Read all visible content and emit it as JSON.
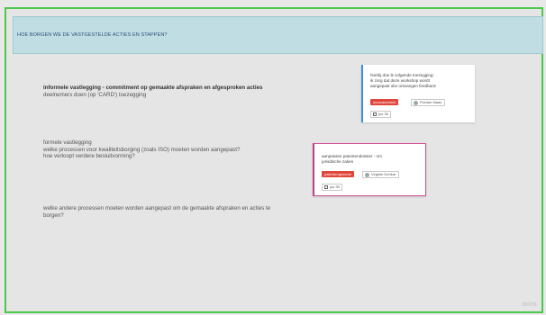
{
  "header": {
    "title": "HOE BORGEN WE DE VASTGESTELDE ACTIES EN STAPPEN?"
  },
  "blocks": [
    {
      "line1": "informele vastlegging - commitment op gemaakte afspraken en afgesproken acties",
      "line2": "deelnemers doen (op 'CARD') toezegging"
    },
    {
      "line1": "formele vastlegging",
      "line2": "welke processen voor kwaliteitsborging (zoals ISO) moeten worden aangepast?",
      "line3": "hoe verloopt verdere besluitvorming?"
    },
    {
      "line1": "welke andere processen moeten worden aangepast om de gemaakte afspraken en acties te",
      "line2": "borgen?"
    }
  ],
  "cards": [
    {
      "text_lines": [
        "hierbij doe ik volgende toezegging:",
        "ik zorg dat deze workshop wordt",
        "aangepast obv ontvangen feedback"
      ],
      "tag": "duurzaamheid",
      "assignee": "Floriam Maas",
      "date": "jun 30",
      "accent": "#3b8fd8"
    },
    {
      "text_lines": [
        "aanpassen patentendossier - om",
        "jurisdische zaken"
      ],
      "tag": "patentengemene",
      "assignee": "Virginie Donkar",
      "date": "jun 30",
      "accent": "#d54f96"
    }
  ],
  "logo": "miro",
  "colors": {
    "header_bg": "#bfdde3",
    "frame_border": "#4cc94c",
    "tag_bg": "#e0463a"
  }
}
